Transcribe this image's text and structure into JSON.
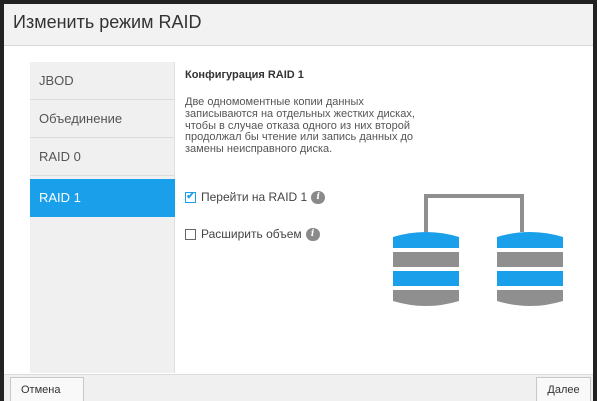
{
  "dialog": {
    "title": "Изменить режим RAID"
  },
  "sidebar": {
    "items": [
      {
        "label": "JBOD"
      },
      {
        "label": "Объединение"
      },
      {
        "label": "RAID 0"
      },
      {
        "label": "RAID 1",
        "selected": true
      }
    ]
  },
  "content": {
    "title": "Конфигурация RAID 1",
    "description": "Две одномоментные копии данных записываются на отдельных жестких дисках, чтобы в случае отказа одного из них второй продолжал бы чтение или запись данных до замены неисправного диска.",
    "options": [
      {
        "label": "Перейти на RAID 1",
        "checked": true,
        "icon": "info-icon"
      },
      {
        "label": "Расширить объем",
        "checked": false,
        "icon": "info-icon"
      }
    ]
  },
  "footer": {
    "cancel_label": "Отмена",
    "next_label": "Далее"
  },
  "colors": {
    "accent": "#1aa0eb",
    "disk_gray": "#8f8f8f"
  }
}
